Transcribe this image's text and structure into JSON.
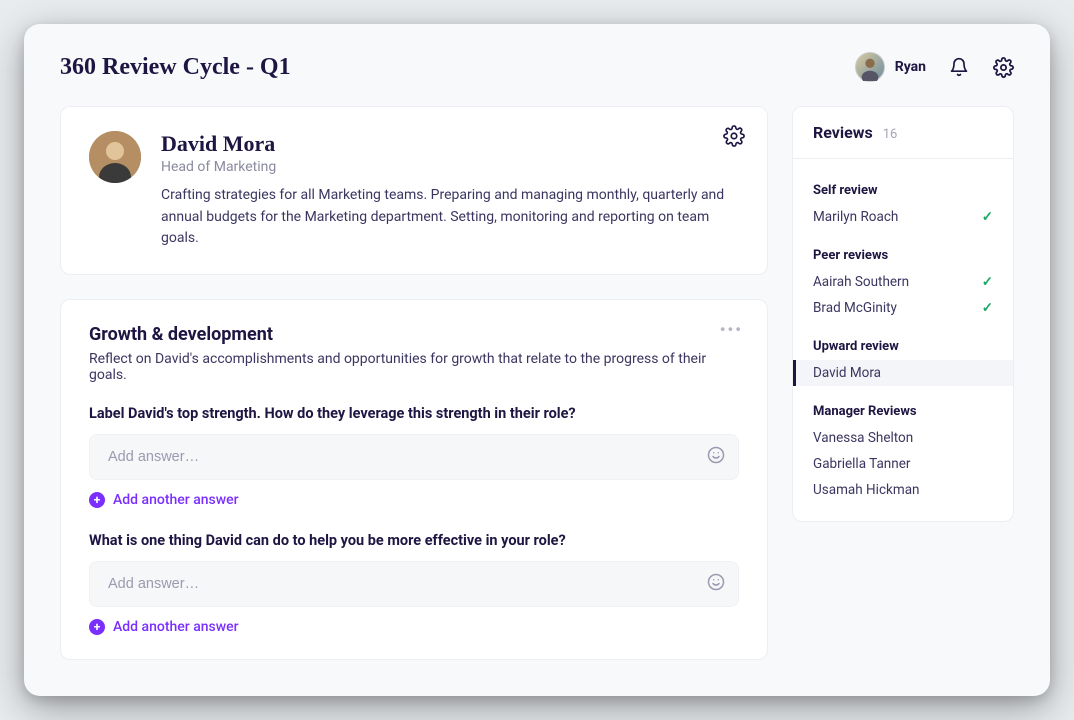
{
  "header": {
    "title": "360 Review Cycle - Q1",
    "user_name": "Ryan"
  },
  "profile": {
    "name": "David Mora",
    "role": "Head of Marketing",
    "description": "Crafting strategies for all Marketing teams. Preparing and managing monthly, quarterly and annual budgets for the Marketing department. Setting, monitoring and reporting on team goals."
  },
  "section": {
    "title": "Growth & development",
    "subtitle": "Reflect on David's accomplishments and opportunities for growth that relate to the progress of their goals.",
    "q1": {
      "label": "Label David's top strength. How do they leverage this strength in their role?",
      "placeholder": "Add answer…",
      "add_label": "Add another answer"
    },
    "q2": {
      "label": "What is one thing David can do to help you be more effective in your role?",
      "placeholder": "Add answer…",
      "add_label": "Add another answer"
    }
  },
  "sidebar": {
    "title": "Reviews",
    "count": "16",
    "groups": {
      "self": {
        "label": "Self review",
        "items": [
          {
            "name": "Marilyn Roach",
            "done": true
          }
        ]
      },
      "peer": {
        "label": "Peer reviews",
        "items": [
          {
            "name": "Aairah Southern",
            "done": true
          },
          {
            "name": "Brad McGinity",
            "done": true
          }
        ]
      },
      "upward": {
        "label": "Upward review",
        "items": [
          {
            "name": "David Mora",
            "done": false,
            "active": true
          }
        ]
      },
      "manager": {
        "label": "Manager Reviews",
        "items": [
          {
            "name": "Vanessa Shelton",
            "done": false
          },
          {
            "name": "Gabriella Tanner",
            "done": false
          },
          {
            "name": "Usamah Hickman",
            "done": false
          }
        ]
      }
    }
  }
}
